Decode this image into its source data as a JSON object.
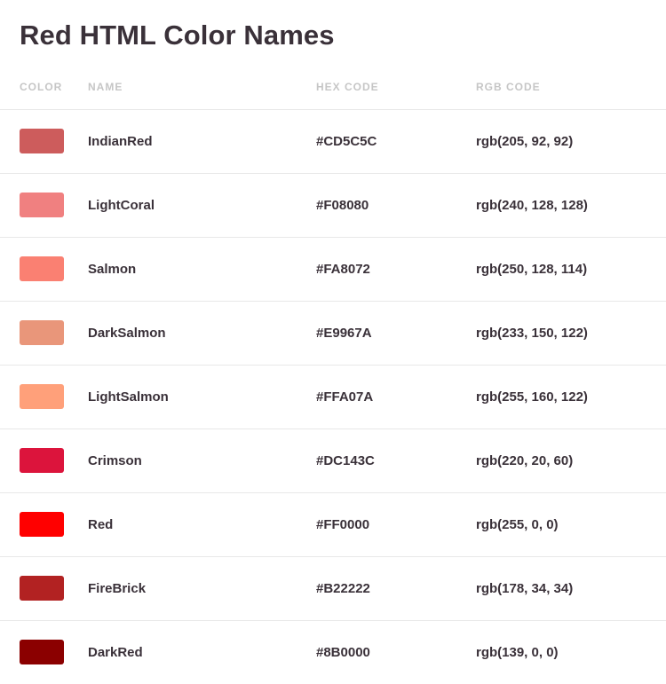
{
  "title": "Red HTML Color Names",
  "columns": {
    "color": "COLOR",
    "name": "NAME",
    "hex": "HEX CODE",
    "rgb": "RGB CODE"
  },
  "colors": [
    {
      "name": "IndianRed",
      "hex": "#CD5C5C",
      "rgb": "rgb(205, 92, 92)",
      "swatch": "#CD5C5C"
    },
    {
      "name": "LightCoral",
      "hex": "#F08080",
      "rgb": "rgb(240, 128, 128)",
      "swatch": "#F08080"
    },
    {
      "name": "Salmon",
      "hex": "#FA8072",
      "rgb": "rgb(250, 128, 114)",
      "swatch": "#FA8072"
    },
    {
      "name": "DarkSalmon",
      "hex": "#E9967A",
      "rgb": "rgb(233, 150, 122)",
      "swatch": "#E9967A"
    },
    {
      "name": "LightSalmon",
      "hex": "#FFA07A",
      "rgb": "rgb(255, 160, 122)",
      "swatch": "#FFA07A"
    },
    {
      "name": "Crimson",
      "hex": "#DC143C",
      "rgb": "rgb(220, 20, 60)",
      "swatch": "#DC143C"
    },
    {
      "name": "Red",
      "hex": "#FF0000",
      "rgb": "rgb(255, 0, 0)",
      "swatch": "#FF0000"
    },
    {
      "name": "FireBrick",
      "hex": "#B22222",
      "rgb": "rgb(178, 34, 34)",
      "swatch": "#B22222"
    },
    {
      "name": "DarkRed",
      "hex": "#8B0000",
      "rgb": "rgb(139, 0, 0)",
      "swatch": "#8B0000"
    }
  ]
}
